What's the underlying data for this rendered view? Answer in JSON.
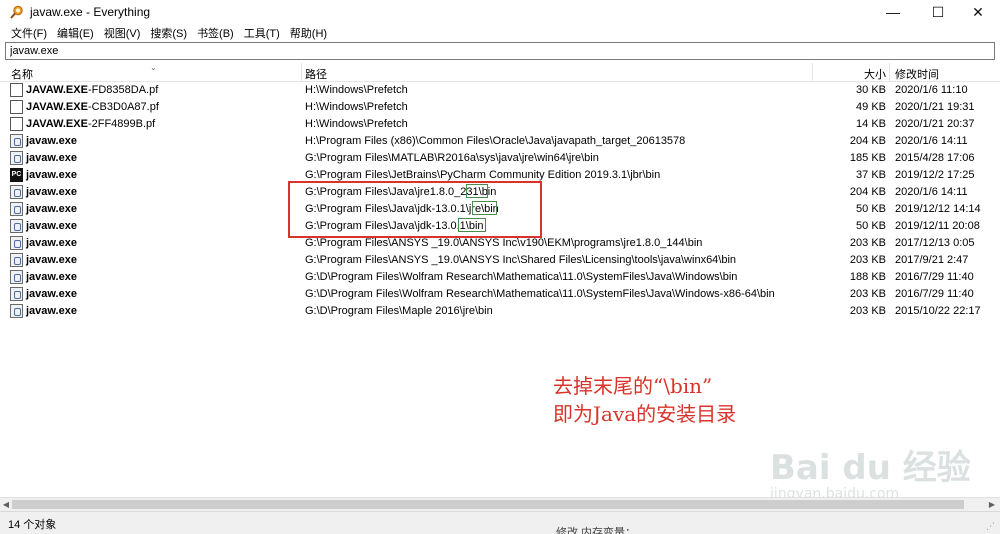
{
  "window": {
    "title": "javaw.exe - Everything",
    "minimize": "—",
    "maximize": "☐",
    "close": "✕"
  },
  "menu": [
    "文件(F)",
    "编辑(E)",
    "视图(V)",
    "搜索(S)",
    "书签(B)",
    "工具(T)",
    "帮助(H)"
  ],
  "search": {
    "value": "javaw.exe"
  },
  "columns": {
    "name": "名称",
    "path": "路径",
    "size": "大小",
    "date": "修改时间"
  },
  "rows": [
    {
      "icon": "file-icon",
      "name_bold": "JAVAW.EXE",
      "name_rest": "-FD8358DA.pf",
      "path": "H:\\Windows\\Prefetch",
      "size": "30 KB",
      "date": "2020/1/6 11:10"
    },
    {
      "icon": "file-icon",
      "name_bold": "JAVAW.EXE",
      "name_rest": "-CB3D0A87.pf",
      "path": "H:\\Windows\\Prefetch",
      "size": "49 KB",
      "date": "2020/1/21 19:31"
    },
    {
      "icon": "file-icon",
      "name_bold": "JAVAW.EXE",
      "name_rest": "-2FF4899B.pf",
      "path": "H:\\Windows\\Prefetch",
      "size": "14 KB",
      "date": "2020/1/21 20:37"
    },
    {
      "icon": "java-icon",
      "name_bold": "javaw.exe",
      "name_rest": "",
      "path": "H:\\Program Files (x86)\\Common Files\\Oracle\\Java\\javapath_target_20613578",
      "size": "204 KB",
      "date": "2020/1/6 14:11"
    },
    {
      "icon": "java-icon",
      "name_bold": "javaw.exe",
      "name_rest": "",
      "path": "G:\\Program Files\\MATLAB\\R2016a\\sys\\java\\jre\\win64\\jre\\bin",
      "size": "185 KB",
      "date": "2015/4/28 17:06"
    },
    {
      "icon": "pycharm-icon",
      "name_bold": "javaw.exe",
      "name_rest": "",
      "path": "G:\\Program Files\\JetBrains\\PyCharm Community Edition 2019.3.1\\jbr\\bin",
      "size": "37 KB",
      "date": "2019/12/2 17:25"
    },
    {
      "icon": "java-icon",
      "name_bold": "javaw.exe",
      "name_rest": "",
      "path": "G:\\Program Files\\Java\\jre1.8.0_231\\bin",
      "size": "204 KB",
      "date": "2020/1/6 14:11"
    },
    {
      "icon": "java-icon",
      "name_bold": "javaw.exe",
      "name_rest": "",
      "path": "G:\\Program Files\\Java\\jdk-13.0.1\\jre\\bin",
      "size": "50 KB",
      "date": "2019/12/12 14:14"
    },
    {
      "icon": "java-icon",
      "name_bold": "javaw.exe",
      "name_rest": "",
      "path": "G:\\Program Files\\Java\\jdk-13.0.1\\bin",
      "size": "50 KB",
      "date": "2019/12/11 20:08"
    },
    {
      "icon": "java-icon",
      "name_bold": "javaw.exe",
      "name_rest": "",
      "path": "G:\\Program Files\\ANSYS _19.0\\ANSYS Inc\\v190\\EKM\\programs\\jre1.8.0_144\\bin",
      "size": "203 KB",
      "date": "2017/12/13 0:05"
    },
    {
      "icon": "java-icon",
      "name_bold": "javaw.exe",
      "name_rest": "",
      "path": "G:\\Program Files\\ANSYS _19.0\\ANSYS Inc\\Shared Files\\Licensing\\tools\\java\\winx64\\bin",
      "size": "203 KB",
      "date": "2017/9/21 2:47"
    },
    {
      "icon": "java-icon",
      "name_bold": "javaw.exe",
      "name_rest": "",
      "path": "G:\\D\\Program Files\\Wolfram Research\\Mathematica\\11.0\\SystemFiles\\Java\\Windows\\bin",
      "size": "188 KB",
      "date": "2016/7/29 11:40"
    },
    {
      "icon": "java-icon",
      "name_bold": "javaw.exe",
      "name_rest": "",
      "path": "G:\\D\\Program Files\\Wolfram Research\\Mathematica\\11.0\\SystemFiles\\Java\\Windows-x86-64\\bin",
      "size": "203 KB",
      "date": "2016/7/29 11:40"
    },
    {
      "icon": "java-icon",
      "name_bold": "javaw.exe",
      "name_rest": "",
      "path": "G:\\D\\Program Files\\Maple 2016\\jre\\bin",
      "size": "203 KB",
      "date": "2015/10/22 22:17"
    }
  ],
  "annotation": {
    "line1": "去掉末尾的“\\bin”",
    "line2": "即为Java的安装目录",
    "color": "#d9342b"
  },
  "watermark": {
    "logo": "Bai du 经验",
    "url": "jingyan.baidu.com"
  },
  "status": {
    "count": "14 个对象",
    "extra": "修改 内存变量："
  }
}
